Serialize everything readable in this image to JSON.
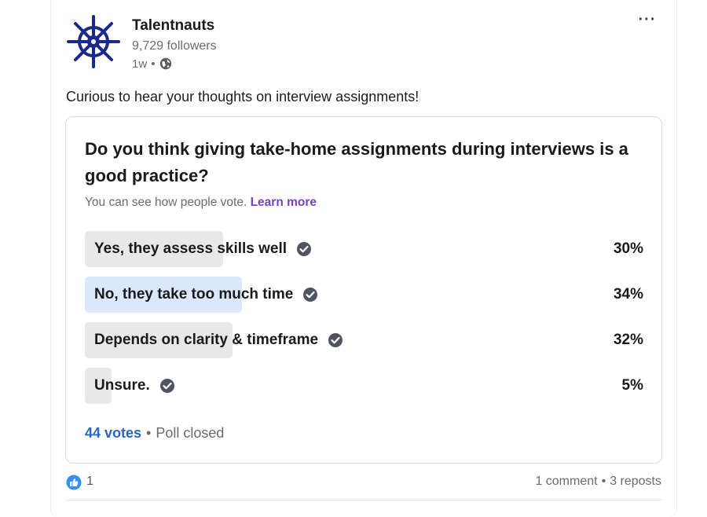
{
  "author": {
    "name": "Talentnauts",
    "followers": "9,729 followers",
    "time": "1w",
    "separator": "•",
    "visibility_icon": "globe-icon"
  },
  "menu": {
    "more_label": "···"
  },
  "post": {
    "text": "Curious to hear your thoughts on interview assignments!"
  },
  "poll": {
    "question": "Do you think giving take-home assignments during interviews is a good practice?",
    "note": "You can see how people vote.",
    "learn_more": "Learn more",
    "options": [
      {
        "label": "Yes, they assess skills well",
        "percent_label": "30%",
        "percent": 30,
        "selected": false
      },
      {
        "label": "No, they take too much time",
        "percent_label": "34%",
        "percent": 34,
        "selected": true
      },
      {
        "label": "Depends on clarity & timeframe",
        "percent_label": "32%",
        "percent": 32,
        "selected": false
      },
      {
        "label": "Unsure.",
        "percent_label": "5%",
        "percent": 5,
        "selected": false
      }
    ],
    "votes": "44 votes",
    "dot": "•",
    "status": "Poll closed"
  },
  "social": {
    "like_count": "1",
    "comments": "1 comment",
    "dot": "•",
    "reposts": "3 reposts"
  },
  "colors": {
    "fill": "#e8e8e8",
    "fill_selected": "#dbe8fb",
    "link": "#2a66bc",
    "learn_more": "#7a3fc9",
    "logo": "#1b2a8a"
  }
}
